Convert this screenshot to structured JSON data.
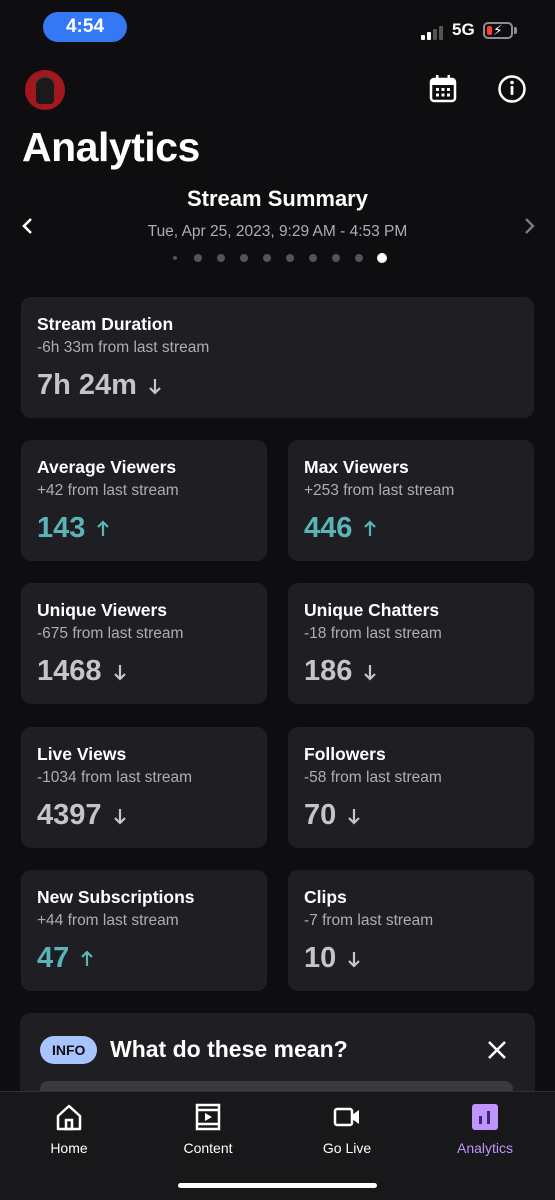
{
  "status_bar": {
    "time": "4:54",
    "network": "5G"
  },
  "header": {
    "title": "Analytics"
  },
  "summary": {
    "title": "Stream Summary",
    "date_range": "Tue, Apr 25, 2023, 9:29 AM - 4:53 PM",
    "page_count": 10,
    "active_page": 10
  },
  "stats": {
    "stream_duration": {
      "label": "Stream Duration",
      "delta": "-6h 33m from last stream",
      "value": "7h 24m",
      "trend": "down"
    },
    "average_viewers": {
      "label": "Average Viewers",
      "delta": "+42 from last stream",
      "value": "143",
      "trend": "up"
    },
    "max_viewers": {
      "label": "Max Viewers",
      "delta": "+253 from last stream",
      "value": "446",
      "trend": "up"
    },
    "unique_viewers": {
      "label": "Unique Viewers",
      "delta": "-675 from last stream",
      "value": "1468",
      "trend": "down"
    },
    "unique_chatters": {
      "label": "Unique Chatters",
      "delta": "-18 from last stream",
      "value": "186",
      "trend": "down"
    },
    "live_views": {
      "label": "Live Views",
      "delta": "-1034 from last stream",
      "value": "4397",
      "trend": "down"
    },
    "followers": {
      "label": "Followers",
      "delta": "-58 from last stream",
      "value": "70",
      "trend": "down"
    },
    "new_subscriptions": {
      "label": "New Subscriptions",
      "delta": "+44 from last stream",
      "value": "47",
      "trend": "up"
    },
    "clips": {
      "label": "Clips",
      "delta": "-7 from last stream",
      "value": "10",
      "trend": "down"
    }
  },
  "info_panel": {
    "badge": "INFO",
    "title": "What do these mean?"
  },
  "bottom_nav": {
    "home": "Home",
    "content": "Content",
    "go_live": "Go Live",
    "analytics": "Analytics",
    "active": "analytics"
  },
  "colors": {
    "background": "#0e0e10",
    "card": "#1f1f23",
    "trend_up": "#5ab5b8",
    "trend_down": "#c4c4cc",
    "accent_purple": "#bf94ff",
    "time_pill": "#3478f6",
    "info_badge": "#a8c4ff"
  }
}
